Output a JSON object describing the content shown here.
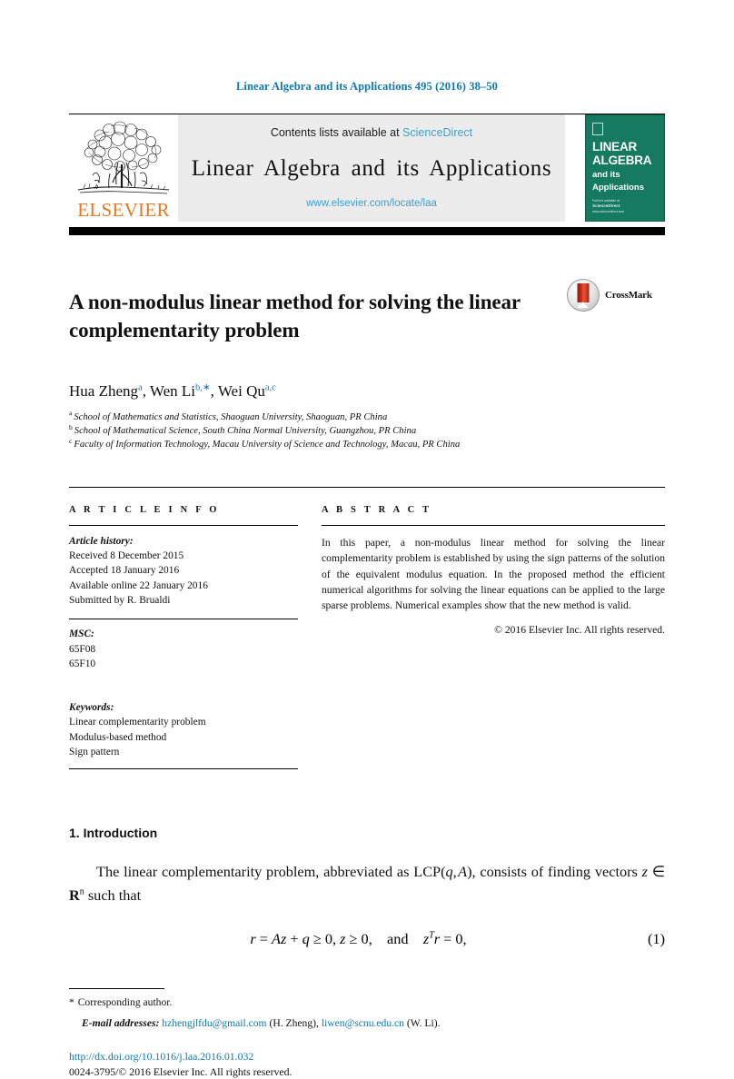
{
  "running_head": "Linear Algebra and its Applications 495 (2016) 38–50",
  "masthead": {
    "publisher_name": "ELSEVIER",
    "contents_prefix": "Contents lists available at ",
    "contents_link": "ScienceDirect",
    "journal_name": "Linear Algebra and its Applications",
    "journal_url": "www.elsevier.com/locate/laa",
    "cover": {
      "line1": "LINEAR",
      "line2": "ALGEBRA",
      "line3": "and its",
      "line4": "Applications",
      "footer_top": "Full text available at",
      "footer_brand": "ScienceDirect",
      "footer_bottom": "www.sciencedirect.com"
    }
  },
  "article": {
    "title": "A non-modulus linear method for solving the linear complementarity problem",
    "crossmark_label": "CrossMark",
    "authors": [
      {
        "name": "Hua Zheng",
        "marks": "a"
      },
      {
        "name": "Wen Li",
        "marks": "b,∗"
      },
      {
        "name": "Wei Qu",
        "marks": "a,c"
      }
    ],
    "affiliations": [
      {
        "mark": "a",
        "text": "School of Mathematics and Statistics, Shaoguan University, Shaoguan, PR China"
      },
      {
        "mark": "b",
        "text": "School of Mathematical Science, South China Normal University, Guangzhou, PR China"
      },
      {
        "mark": "c",
        "text": "Faculty of Information Technology, Macau University of Science and Technology, Macau, PR China"
      }
    ]
  },
  "article_info": {
    "heading": "A R T I C L E   I N F O",
    "history_label": "Article history:",
    "history": [
      "Received 8 December 2015",
      "Accepted 18 January 2016",
      "Available online 22 January 2016",
      "Submitted by R. Brualdi"
    ],
    "msc_label": "MSC:",
    "msc": [
      "65F08",
      "65F10"
    ],
    "keywords_label": "Keywords:",
    "keywords": [
      "Linear complementarity problem",
      "Modulus-based method",
      "Sign pattern"
    ]
  },
  "abstract": {
    "heading": "A B S T R A C T",
    "text": "In this paper, a non-modulus linear method for solving the linear complementarity problem is established by using the sign patterns of the solution of the equivalent modulus equation. In the proposed method the efficient numerical algorithms for solving the linear equations can be applied to the large sparse problems. Numerical examples show that the new method is valid.",
    "copyright": "© 2016 Elsevier Inc. All rights reserved."
  },
  "body": {
    "section_number_title": "1.  Introduction",
    "paragraph_1_a": "The linear complementarity problem, abbreviated as LCP(",
    "paragraph_1_b": "), consists of finding vectors ",
    "paragraph_1_c": " such that",
    "equation_1_number": "(1)"
  },
  "footnotes": {
    "corresponding": "Corresponding author.",
    "email_label": "E-mail addresses:",
    "email_1": "hzhengjlfdu@gmail.com",
    "email_1_owner": "(H. Zheng),",
    "email_2": "liwen@scnu.edu.cn",
    "email_2_owner": "(W. Li).",
    "doi": "http://dx.doi.org/10.1016/j.laa.2016.01.032",
    "issn": "0024-3795/© 2016 Elsevier Inc. All rights reserved."
  }
}
